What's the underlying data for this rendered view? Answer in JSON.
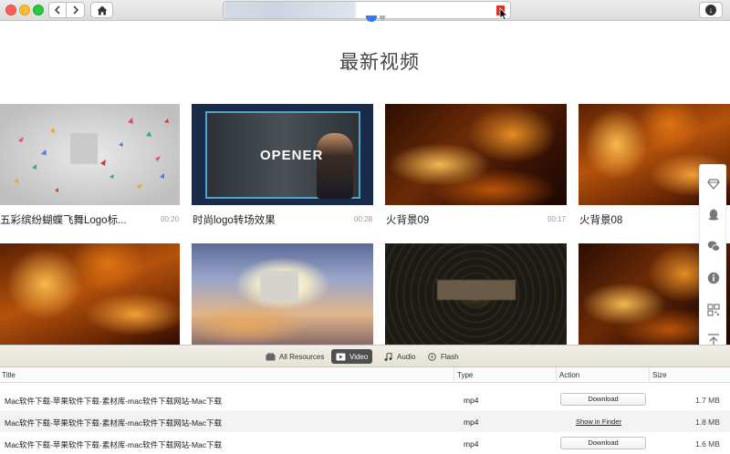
{
  "window": {
    "nav_back_icon": "chevron-left-icon",
    "nav_forward_icon": "chevron-right-icon",
    "home_icon": "home-icon",
    "download_icon": "download-circle-icon"
  },
  "page": {
    "title": "最新视频"
  },
  "videos": [
    {
      "title": "五彩缤纷蝴蝶飞舞Logo标...",
      "duration": "00:20"
    },
    {
      "title": "时尚logo转场效果",
      "duration": "00:28",
      "thumb_text": "OPENER"
    },
    {
      "title": "火背景09",
      "duration": "00:17"
    },
    {
      "title": "火背景08",
      "duration": ""
    }
  ],
  "side_tools": [
    "diamond-icon",
    "qq-penguin-icon",
    "wechat-icon",
    "info-icon",
    "qr-code-icon",
    "back-to-top-icon"
  ],
  "filters": [
    {
      "label": "All Resources",
      "icon": "resources-icon",
      "active": false
    },
    {
      "label": "Video",
      "icon": "video-icon",
      "active": true
    },
    {
      "label": "Audio",
      "icon": "music-note-icon",
      "active": false
    },
    {
      "label": "Flash",
      "icon": "flash-icon",
      "active": false
    }
  ],
  "table": {
    "headers": {
      "title": "Title",
      "type": "Type",
      "action": "Action",
      "size": "Size"
    },
    "rows": [
      {
        "title": "Mac软件下载-苹果软件下载-素材库-mac软件下载网站-Mac下载",
        "type": "mp4",
        "action": "Download",
        "size": "1.7 MB"
      },
      {
        "title": "Mac软件下载-苹果软件下载-素材库-mac软件下载网站-Mac下载",
        "type": "mp4",
        "action": "Show in Finder",
        "size": "1.8 MB"
      },
      {
        "title": "Mac软件下载-苹果软件下载-素材库-mac软件下载网站-Mac下载",
        "type": "mp4",
        "action": "Download",
        "size": "1.6 MB"
      }
    ]
  },
  "colors": {
    "accent_blue": "#3478f6",
    "stop_red": "#d9302a",
    "active_filter": "#4f4f4f"
  }
}
